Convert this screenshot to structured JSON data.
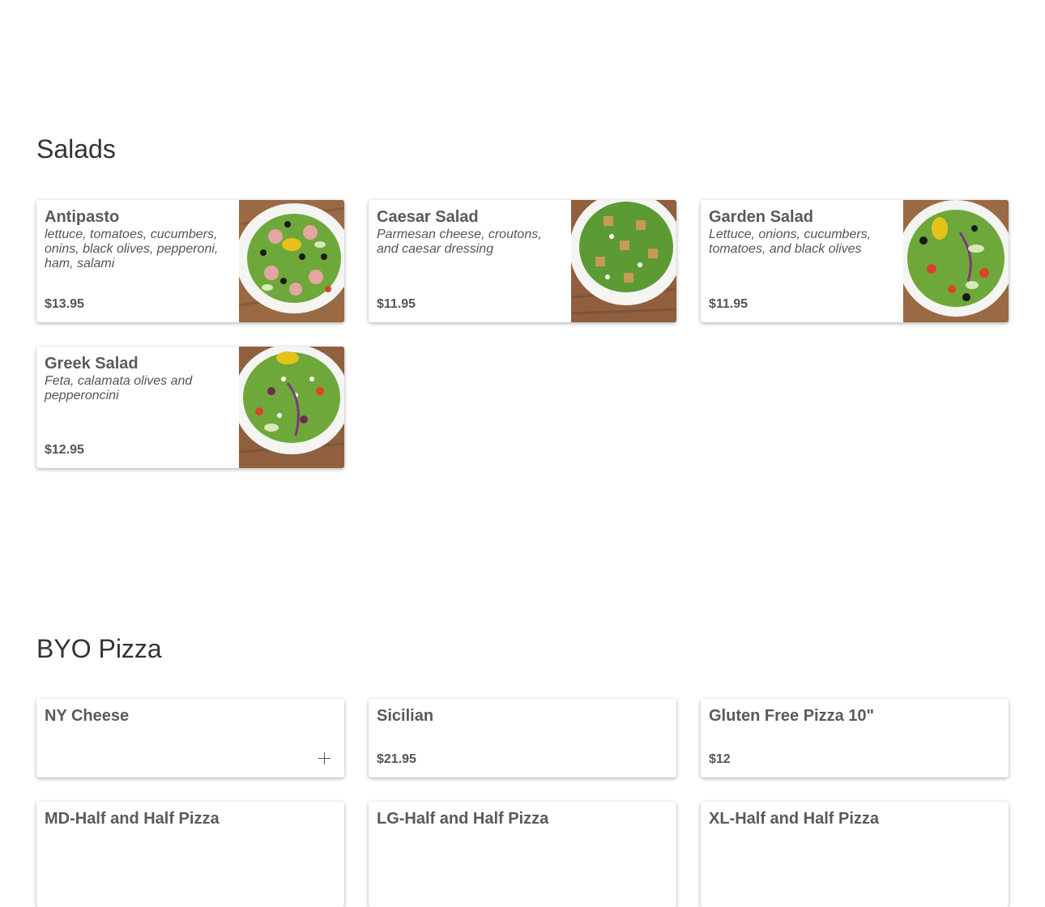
{
  "sections": {
    "salads": {
      "title": "Salads",
      "items": [
        {
          "name": "Antipasto",
          "description": "lettuce, tomatoes, cucumbers, onins, black olives, pepperoni, ham, salami",
          "price": "$13.95",
          "photo": "antipasto-salad-photo"
        },
        {
          "name": "Caesar Salad",
          "description": "Parmesan cheese, croutons, and caesar dressing",
          "price": "$11.95",
          "photo": "caesar-salad-photo"
        },
        {
          "name": "Garden Salad",
          "description": "Lettuce, onions, cucumbers, tomatoes, and black olives",
          "price": "$11.95",
          "photo": "garden-salad-photo"
        },
        {
          "name": "Greek Salad",
          "description": "Feta, calamata olives and pepperoncini",
          "price": "$12.95",
          "photo": "greek-salad-photo"
        }
      ]
    },
    "byo_pizza": {
      "title": "BYO Pizza",
      "items": [
        {
          "name": "NY Cheese",
          "price": "",
          "action_icon": "plus-icon"
        },
        {
          "name": "Sicilian",
          "price": "$21.95"
        },
        {
          "name": "Gluten Free Pizza 10\"",
          "price": "$12"
        },
        {
          "name": "MD-Half and Half Pizza",
          "price": ""
        },
        {
          "name": "LG-Half and Half Pizza",
          "price": ""
        },
        {
          "name": "XL-Half and Half Pizza",
          "price": ""
        }
      ]
    }
  },
  "colors": {
    "background": "#ffffff",
    "heading": "#333333",
    "text": "#555555",
    "wood": "#8a5a3a",
    "plate": "#f4f4f2",
    "lettuce": "#6fa83a",
    "tomato": "#d9432c",
    "olive": "#1a1a1a",
    "pepperoncini": "#e5c21a",
    "cucumber": "#d8e8b8",
    "crouton": "#c89a55",
    "feta": "#ffffff",
    "ham": "#e3a6a0"
  }
}
